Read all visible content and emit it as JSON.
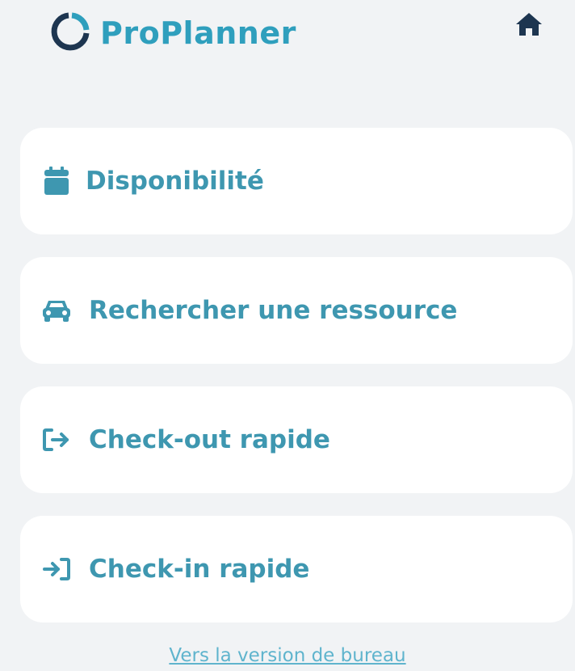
{
  "brand": {
    "name": "ProPlanner",
    "logo_icon": "ring-logo-icon",
    "brand_color": "#2f9fbd",
    "accent_dark": "#1d3550"
  },
  "header": {
    "home_icon": "home-icon"
  },
  "menu": {
    "items": [
      {
        "label": "Disponibilité",
        "icon": "calendar-icon"
      },
      {
        "label": "Rechercher une ressource",
        "icon": "car-icon"
      },
      {
        "label": "Check-out rapide",
        "icon": "sign-out-icon"
      },
      {
        "label": "Check-in rapide",
        "icon": "sign-in-icon"
      }
    ],
    "label_color": "#3e97b0",
    "icon_color": "#3e97b0"
  },
  "footer": {
    "desktop_link": "Vers la version de bureau",
    "link_color": "#5fb4cd"
  }
}
